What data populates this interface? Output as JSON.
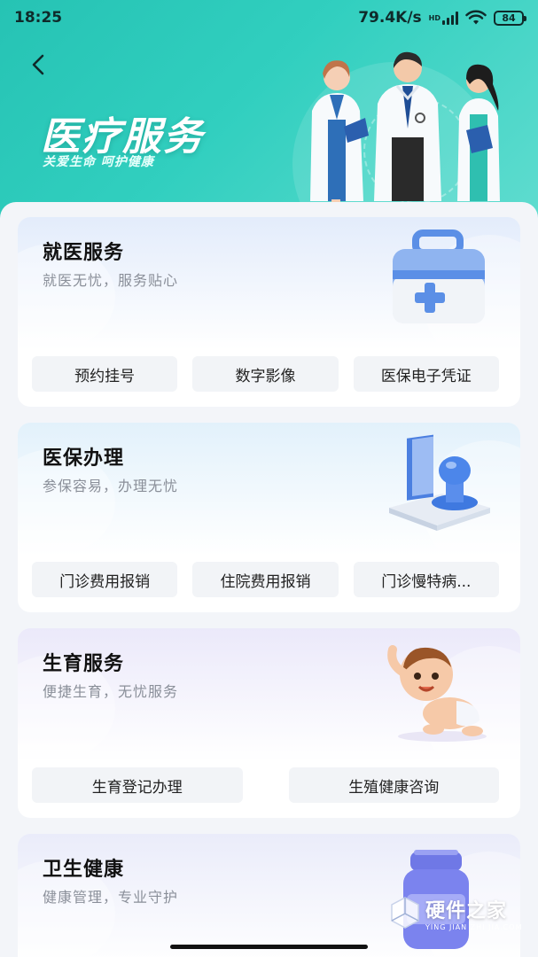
{
  "status_bar": {
    "time": "18:25",
    "network_speed": "79.4K/s",
    "network_badge": "HD",
    "battery": "84"
  },
  "header": {
    "title": "医疗服务",
    "subtitle": "关爱生命 呵护健康",
    "back_icon": "chevron-left-icon",
    "accent_color": "#2ec8b8"
  },
  "sections": [
    {
      "title": "就医服务",
      "subtitle": "就医无忧，服务贴心",
      "icon": "medical-kit-icon",
      "tint": "#e6eefb",
      "buttons": [
        "预约挂号",
        "数字影像",
        "医保电子凭证"
      ]
    },
    {
      "title": "医保办理",
      "subtitle": "参保容易，办理无忧",
      "icon": "stamp-icon",
      "tint": "#e5f3fb",
      "buttons": [
        "门诊费用报销",
        "住院费用报销",
        "门诊慢特病..."
      ]
    },
    {
      "title": "生育服务",
      "subtitle": "便捷生育，无忧服务",
      "icon": "baby-icon",
      "tint": "#eceaf9",
      "buttons": [
        "生育登记办理",
        "生殖健康咨询"
      ]
    },
    {
      "title": "卫生健康",
      "subtitle": "健康管理，专业守护",
      "icon": "medicine-bottle-icon",
      "tint": "#ebedfa",
      "buttons": []
    }
  ],
  "watermark": {
    "title": "硬件之家",
    "subtitle": "YING JIAN ZHI JIA.COM"
  }
}
